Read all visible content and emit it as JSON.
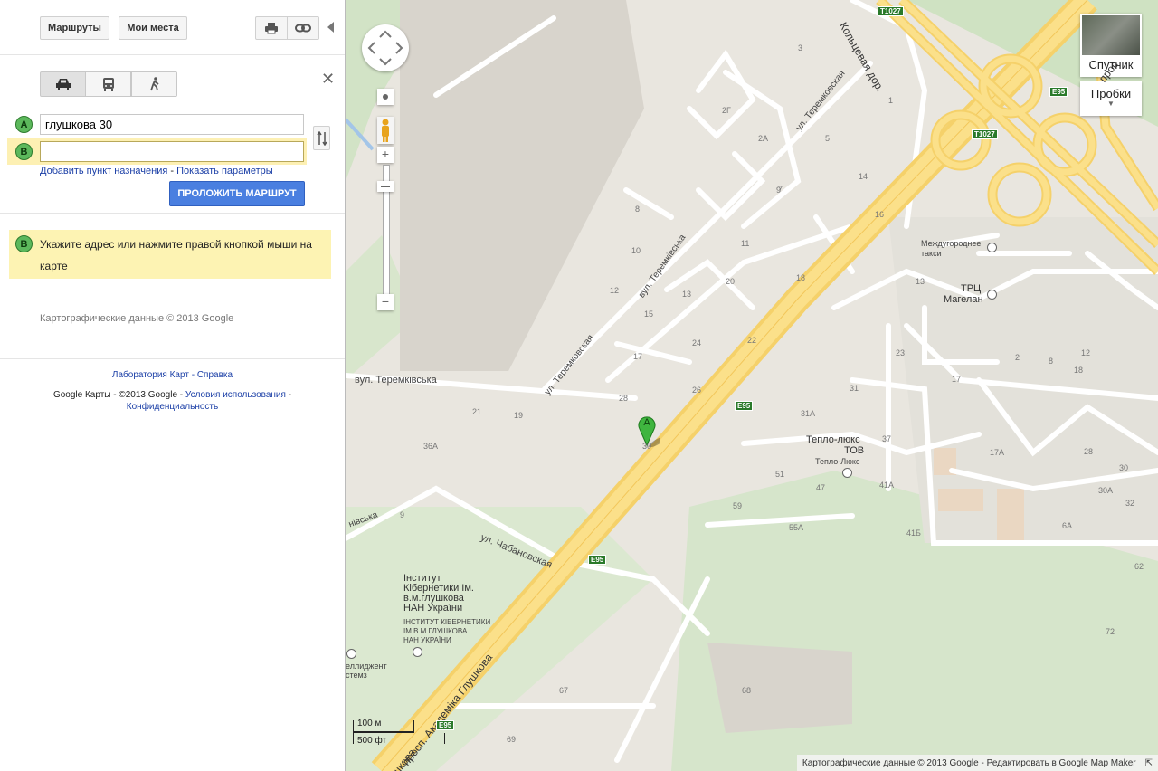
{
  "toolbar": {
    "directions_label": "Маршруты",
    "my_places_label": "Мои места"
  },
  "directions": {
    "modes": [
      "driving",
      "transit",
      "walking"
    ],
    "marker_a": "A",
    "marker_b": "B",
    "origin_value": "глушкова 30",
    "destination_value": "",
    "add_destination_link": "Добавить пункт назначения",
    "separator": "-",
    "show_options_link": "Показать параметры",
    "route_button": "ПРОЛОЖИТЬ МАРШРУТ",
    "hint_marker": "B",
    "hint_text": "Укажите адрес или нажмите правой кнопкой мыши на карте",
    "attribution": "Картографические данные © 2013 Google"
  },
  "footer": {
    "labs_link": "Лаборатория Карт",
    "sep1": "-",
    "help_link": "Справка",
    "brand": "Google Карты",
    "sep2": "-",
    "copyright": "©2013 Google",
    "sep3": "-",
    "terms_link": "Условия использования",
    "sep4": "-",
    "privacy_link": "Конфиденциальность"
  },
  "map": {
    "satellite_label": "Спутник",
    "traffic_label": "Пробки",
    "scale_metric": "100 м",
    "scale_imperial": "500 фт",
    "bottom_attribution": "Картографические данные © 2013 Google -",
    "edit_link": "Редактировать в Google Map Maker",
    "pin_label": "A",
    "streets": {
      "ring_road": "Кольцевая дор.",
      "glushkova_ave": "просп. Академіка Глушкова",
      "glushkova_bottom": "шкова",
      "teremkovskaya_ru": "ул. Теремковская",
      "teremkivska_ua": "вул. Теремківська",
      "teremkovskaya_ru_2": "ул. Теремковская",
      "teremkivska_ua_2": "вул. Теремківська",
      "teremkivska_ua_3": "вул. Теремківська",
      "chabanovskaya": "ул. Чабановская",
      "ivska": "нівська",
      "prosp_top": "прос"
    },
    "road_badges": {
      "t1027_top": "T1027",
      "t1027_mid": "T1027",
      "e95_a": "E95",
      "e95_b": "E95",
      "e95_c": "E95",
      "e95_d": "E95"
    },
    "pois": {
      "intercity_taxi": "Междугороднее такси",
      "trc_line1": "ТРЦ",
      "trc_line2": "Магелан",
      "teplo_line1": "Тепло-люкс",
      "teplo_line2": "ТОВ",
      "teplo_sub": "Тепло-Люкс",
      "inst_ua_1": "Інститут",
      "inst_ua_2": "Кібернетики Ім.",
      "inst_ua_3": "в.м.глушкова",
      "inst_ua_4": "НАН України",
      "inst_caps_1": "ІНСТИТУТ КІБЕРНЕТИКИ",
      "inst_caps_2": "ІМ.В.М.ГЛУШКОВА",
      "inst_caps_3": "НАН УКРАЇНИ",
      "intel_1": "еллиджент",
      "intel_2": "стемз"
    },
    "house_numbers": [
      {
        "t": "3"
      },
      {
        "t": "1"
      },
      {
        "t": "2Г"
      },
      {
        "t": "2А"
      },
      {
        "t": "5"
      },
      {
        "t": "7"
      },
      {
        "t": "14"
      },
      {
        "t": "9"
      },
      {
        "t": "16"
      },
      {
        "t": "8"
      },
      {
        "t": "11"
      },
      {
        "t": "10"
      },
      {
        "t": "20"
      },
      {
        "t": "18"
      },
      {
        "t": "12"
      },
      {
        "t": "13"
      },
      {
        "t": "15"
      },
      {
        "t": "24"
      },
      {
        "t": "22"
      },
      {
        "t": "17"
      },
      {
        "t": "26"
      },
      {
        "t": "28"
      },
      {
        "t": "21"
      },
      {
        "t": "19"
      },
      {
        "t": "36А"
      },
      {
        "t": "30"
      },
      {
        "t": "31А"
      },
      {
        "t": "51"
      },
      {
        "t": "47"
      },
      {
        "t": "37"
      },
      {
        "t": "31"
      },
      {
        "t": "41А"
      },
      {
        "t": "59"
      },
      {
        "t": "55А"
      },
      {
        "t": "41Б"
      },
      {
        "t": "9"
      },
      {
        "t": "23"
      },
      {
        "t": "2"
      },
      {
        "t": "8"
      },
      {
        "t": "12"
      },
      {
        "t": "18"
      },
      {
        "t": "17"
      },
      {
        "t": "17А"
      },
      {
        "t": "28"
      },
      {
        "t": "30"
      },
      {
        "t": "30А"
      },
      {
        "t": "32"
      },
      {
        "t": "6А"
      },
      {
        "t": "62"
      },
      {
        "t": "72"
      },
      {
        "t": "67"
      },
      {
        "t": "68"
      },
      {
        "t": "69"
      },
      {
        "t": "13"
      }
    ]
  }
}
